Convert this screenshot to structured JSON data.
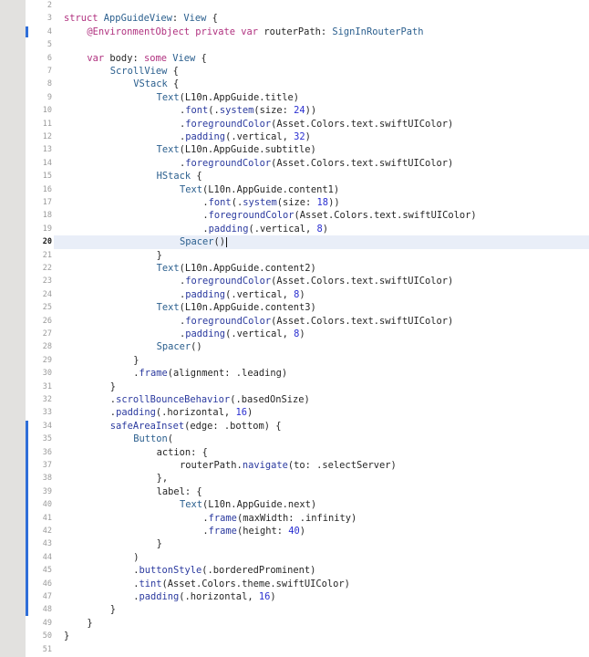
{
  "editor": {
    "current_line": 20,
    "change_bar_ranges": [
      [
        4,
        4
      ],
      [
        34,
        48
      ]
    ],
    "lines": [
      {
        "n": "2",
        "indent": 0,
        "segments": []
      },
      {
        "n": "3",
        "indent": 0,
        "segments": [
          [
            "kw",
            "struct "
          ],
          [
            "ty",
            "AppGuideView"
          ],
          [
            "tx",
            ": "
          ],
          [
            "ty",
            "View"
          ],
          [
            "tx",
            " {"
          ]
        ]
      },
      {
        "n": "4",
        "indent": 1,
        "segments": [
          [
            "kw",
            "@EnvironmentObject private var "
          ],
          [
            "tx",
            "routerPath: "
          ],
          [
            "ty",
            "SignInRouterPath"
          ]
        ]
      },
      {
        "n": "5",
        "indent": 0,
        "segments": []
      },
      {
        "n": "6",
        "indent": 1,
        "segments": [
          [
            "kw",
            "var "
          ],
          [
            "tx",
            "body: "
          ],
          [
            "kw",
            "some "
          ],
          [
            "ty",
            "View"
          ],
          [
            "tx",
            " {"
          ]
        ]
      },
      {
        "n": "7",
        "indent": 2,
        "segments": [
          [
            "ty",
            "ScrollView"
          ],
          [
            "tx",
            " {"
          ]
        ]
      },
      {
        "n": "8",
        "indent": 3,
        "segments": [
          [
            "ty",
            "VStack"
          ],
          [
            "tx",
            " {"
          ]
        ]
      },
      {
        "n": "9",
        "indent": 4,
        "segments": [
          [
            "ty",
            "Text"
          ],
          [
            "tx",
            "(L10n.AppGuide.title)"
          ]
        ]
      },
      {
        "n": "10",
        "indent": 5,
        "segments": [
          [
            "tx",
            "."
          ],
          [
            "fn",
            "font"
          ],
          [
            "tx",
            "(."
          ],
          [
            "fn",
            "system"
          ],
          [
            "tx",
            "(size: "
          ],
          [
            "num",
            "24"
          ],
          [
            "tx",
            "))"
          ]
        ]
      },
      {
        "n": "11",
        "indent": 5,
        "segments": [
          [
            "tx",
            "."
          ],
          [
            "fn",
            "foregroundColor"
          ],
          [
            "tx",
            "(Asset.Colors.text.swiftUIColor)"
          ]
        ]
      },
      {
        "n": "12",
        "indent": 5,
        "segments": [
          [
            "tx",
            "."
          ],
          [
            "fn",
            "padding"
          ],
          [
            "tx",
            "(.vertical, "
          ],
          [
            "num",
            "32"
          ],
          [
            "tx",
            ")"
          ]
        ]
      },
      {
        "n": "13",
        "indent": 4,
        "segments": [
          [
            "ty",
            "Text"
          ],
          [
            "tx",
            "(L10n.AppGuide.subtitle)"
          ]
        ]
      },
      {
        "n": "14",
        "indent": 5,
        "segments": [
          [
            "tx",
            "."
          ],
          [
            "fn",
            "foregroundColor"
          ],
          [
            "tx",
            "(Asset.Colors.text.swiftUIColor)"
          ]
        ]
      },
      {
        "n": "15",
        "indent": 4,
        "segments": [
          [
            "ty",
            "HStack"
          ],
          [
            "tx",
            " {"
          ]
        ]
      },
      {
        "n": "16",
        "indent": 5,
        "segments": [
          [
            "ty",
            "Text"
          ],
          [
            "tx",
            "(L10n.AppGuide.content1)"
          ]
        ]
      },
      {
        "n": "17",
        "indent": 6,
        "segments": [
          [
            "tx",
            "."
          ],
          [
            "fn",
            "font"
          ],
          [
            "tx",
            "(."
          ],
          [
            "fn",
            "system"
          ],
          [
            "tx",
            "(size: "
          ],
          [
            "num",
            "18"
          ],
          [
            "tx",
            "))"
          ]
        ]
      },
      {
        "n": "18",
        "indent": 6,
        "segments": [
          [
            "tx",
            "."
          ],
          [
            "fn",
            "foregroundColor"
          ],
          [
            "tx",
            "(Asset.Colors.text.swiftUIColor)"
          ]
        ]
      },
      {
        "n": "19",
        "indent": 6,
        "segments": [
          [
            "tx",
            "."
          ],
          [
            "fn",
            "padding"
          ],
          [
            "tx",
            "(.vertical, "
          ],
          [
            "num",
            "8"
          ],
          [
            "tx",
            ")"
          ]
        ]
      },
      {
        "n": "20",
        "indent": 5,
        "segments": [
          [
            "ty",
            "Spacer"
          ],
          [
            "tx",
            "()"
          ]
        ]
      },
      {
        "n": "21",
        "indent": 4,
        "segments": [
          [
            "tx",
            "}"
          ]
        ]
      },
      {
        "n": "22",
        "indent": 4,
        "segments": [
          [
            "ty",
            "Text"
          ],
          [
            "tx",
            "(L10n.AppGuide.content2)"
          ]
        ]
      },
      {
        "n": "23",
        "indent": 5,
        "segments": [
          [
            "tx",
            "."
          ],
          [
            "fn",
            "foregroundColor"
          ],
          [
            "tx",
            "(Asset.Colors.text.swiftUIColor)"
          ]
        ]
      },
      {
        "n": "24",
        "indent": 5,
        "segments": [
          [
            "tx",
            "."
          ],
          [
            "fn",
            "padding"
          ],
          [
            "tx",
            "(.vertical, "
          ],
          [
            "num",
            "8"
          ],
          [
            "tx",
            ")"
          ]
        ]
      },
      {
        "n": "25",
        "indent": 4,
        "segments": [
          [
            "ty",
            "Text"
          ],
          [
            "tx",
            "(L10n.AppGuide.content3)"
          ]
        ]
      },
      {
        "n": "26",
        "indent": 5,
        "segments": [
          [
            "tx",
            "."
          ],
          [
            "fn",
            "foregroundColor"
          ],
          [
            "tx",
            "(Asset.Colors.text.swiftUIColor)"
          ]
        ]
      },
      {
        "n": "27",
        "indent": 5,
        "segments": [
          [
            "tx",
            "."
          ],
          [
            "fn",
            "padding"
          ],
          [
            "tx",
            "(.vertical, "
          ],
          [
            "num",
            "8"
          ],
          [
            "tx",
            ")"
          ]
        ]
      },
      {
        "n": "28",
        "indent": 4,
        "segments": [
          [
            "ty",
            "Spacer"
          ],
          [
            "tx",
            "()"
          ]
        ]
      },
      {
        "n": "29",
        "indent": 3,
        "segments": [
          [
            "tx",
            "}"
          ]
        ]
      },
      {
        "n": "30",
        "indent": 3,
        "segments": [
          [
            "tx",
            "."
          ],
          [
            "fn",
            "frame"
          ],
          [
            "tx",
            "(alignment: .leading)"
          ]
        ]
      },
      {
        "n": "31",
        "indent": 2,
        "segments": [
          [
            "tx",
            "}"
          ]
        ]
      },
      {
        "n": "32",
        "indent": 2,
        "segments": [
          [
            "tx",
            "."
          ],
          [
            "fn",
            "scrollBounceBehavior"
          ],
          [
            "tx",
            "(.basedOnSize)"
          ]
        ]
      },
      {
        "n": "33",
        "indent": 2,
        "segments": [
          [
            "tx",
            "."
          ],
          [
            "fn",
            "padding"
          ],
          [
            "tx",
            "(.horizontal, "
          ],
          [
            "num",
            "16"
          ],
          [
            "tx",
            ")"
          ]
        ]
      },
      {
        "n": "34",
        "indent": 2,
        "segments": [
          [
            "fn",
            "safeAreaInset"
          ],
          [
            "tx",
            "(edge: .bottom) {"
          ]
        ]
      },
      {
        "n": "35",
        "indent": 3,
        "segments": [
          [
            "ty",
            "Button"
          ],
          [
            "tx",
            "("
          ]
        ]
      },
      {
        "n": "36",
        "indent": 4,
        "segments": [
          [
            "tx",
            "action: {"
          ]
        ]
      },
      {
        "n": "37",
        "indent": 5,
        "segments": [
          [
            "tx",
            "routerPath."
          ],
          [
            "fn",
            "navigate"
          ],
          [
            "tx",
            "(to: .selectServer)"
          ]
        ]
      },
      {
        "n": "38",
        "indent": 4,
        "segments": [
          [
            "tx",
            "},"
          ]
        ]
      },
      {
        "n": "39",
        "indent": 4,
        "segments": [
          [
            "tx",
            "label: {"
          ]
        ]
      },
      {
        "n": "40",
        "indent": 5,
        "segments": [
          [
            "ty",
            "Text"
          ],
          [
            "tx",
            "(L10n.AppGuide.next)"
          ]
        ]
      },
      {
        "n": "41",
        "indent": 6,
        "segments": [
          [
            "tx",
            "."
          ],
          [
            "fn",
            "frame"
          ],
          [
            "tx",
            "(maxWidth: .infinity)"
          ]
        ]
      },
      {
        "n": "42",
        "indent": 6,
        "segments": [
          [
            "tx",
            "."
          ],
          [
            "fn",
            "frame"
          ],
          [
            "tx",
            "(height: "
          ],
          [
            "num",
            "40"
          ],
          [
            "tx",
            ")"
          ]
        ]
      },
      {
        "n": "43",
        "indent": 4,
        "segments": [
          [
            "tx",
            "}"
          ]
        ]
      },
      {
        "n": "44",
        "indent": 3,
        "segments": [
          [
            "tx",
            ")"
          ]
        ]
      },
      {
        "n": "45",
        "indent": 3,
        "segments": [
          [
            "tx",
            "."
          ],
          [
            "fn",
            "buttonStyle"
          ],
          [
            "tx",
            "(.borderedProminent)"
          ]
        ]
      },
      {
        "n": "46",
        "indent": 3,
        "segments": [
          [
            "tx",
            "."
          ],
          [
            "fn",
            "tint"
          ],
          [
            "tx",
            "(Asset.Colors.theme.swiftUIColor)"
          ]
        ]
      },
      {
        "n": "47",
        "indent": 3,
        "segments": [
          [
            "tx",
            "."
          ],
          [
            "fn",
            "padding"
          ],
          [
            "tx",
            "(.horizontal, "
          ],
          [
            "num",
            "16"
          ],
          [
            "tx",
            ")"
          ]
        ]
      },
      {
        "n": "48",
        "indent": 2,
        "segments": [
          [
            "tx",
            "}"
          ]
        ]
      },
      {
        "n": "49",
        "indent": 1,
        "segments": [
          [
            "tx",
            "}"
          ]
        ]
      },
      {
        "n": "50",
        "indent": 0,
        "segments": [
          [
            "tx",
            "}"
          ]
        ]
      },
      {
        "n": "51",
        "indent": 0,
        "segments": []
      }
    ]
  }
}
